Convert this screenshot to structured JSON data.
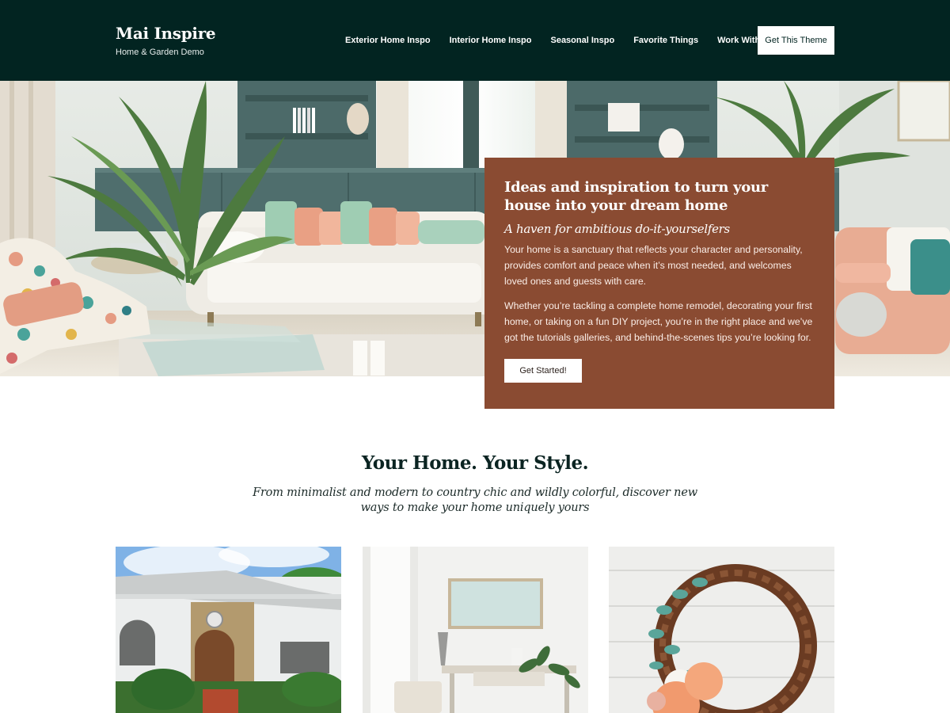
{
  "header": {
    "brand_title": "Mai Inspire",
    "brand_tagline": "Home & Garden Demo",
    "nav": [
      {
        "label": "Exterior Home Inspo"
      },
      {
        "label": "Interior Home Inspo"
      },
      {
        "label": "Seasonal Inspo"
      },
      {
        "label": "Favorite Things"
      },
      {
        "label": "Work With Me"
      }
    ],
    "cta_label": "Get This Theme"
  },
  "hero": {
    "heading": "Ideas and inspiration to turn your house into your dream home",
    "subheading": "A haven for ambitious do-it-yourselfers",
    "paragraph_1": "Your home is a sanctuary that reflects your character and personality, provides comfort and peace when it’s most needed, and welcomes loved ones and guests with care.",
    "paragraph_2": "Whether you’re tackling a complete home remodel, decorating your first home, or taking on a fun DIY project, you’re in the right place and we’ve got the tutorials galleries, and behind-the-scenes tips you’re looking for.",
    "button_label": "Get Started!"
  },
  "section": {
    "title": "Your Home. Your Style.",
    "subtitle": "From minimalist and modern to country chic and wildly colorful, discover new ways to make your home uniquely yours"
  },
  "colors": {
    "header_bg": "#022421",
    "hero_card_bg": "#8a4b32",
    "heading_text": "#0b2422"
  }
}
